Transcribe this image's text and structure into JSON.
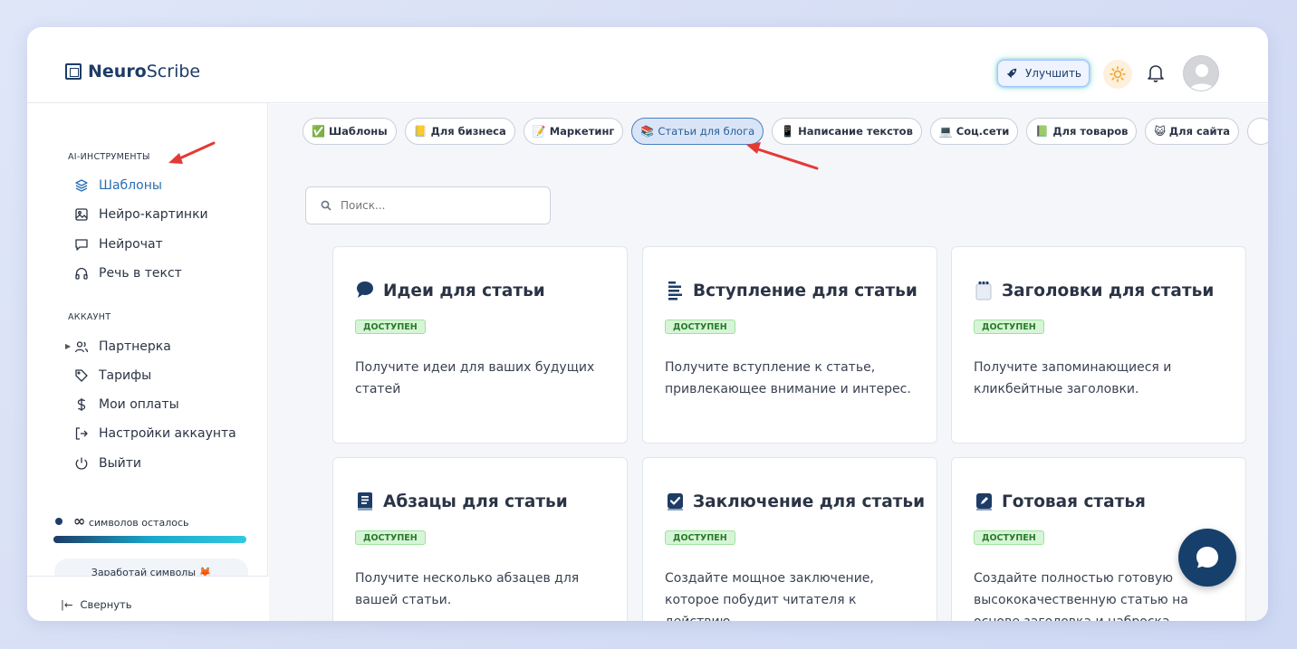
{
  "app": {
    "brand_bold": "Neuro",
    "brand_light": "Scribe"
  },
  "header": {
    "upgrade_label": "Улучшить"
  },
  "sidebar": {
    "section_tools": "AI-ИНСТРУМЕНТЫ",
    "tools": [
      {
        "label": "Шаблоны",
        "icon": "layers-icon",
        "active": true
      },
      {
        "label": "Нейро-картинки",
        "icon": "image-icon"
      },
      {
        "label": "Нейрочат",
        "icon": "chat-icon"
      },
      {
        "label": "Речь в текст",
        "icon": "headphones-icon"
      }
    ],
    "section_account": "АККАУНТ",
    "account": [
      {
        "label": "Партнерка",
        "icon": "users-icon"
      },
      {
        "label": "Тарифы",
        "icon": "tag-icon"
      },
      {
        "label": "Мои оплаты",
        "icon": "dollar-icon"
      },
      {
        "label": "Настройки аккаунта",
        "icon": "logout-icon"
      },
      {
        "label": "Выйти",
        "icon": "power-icon"
      }
    ],
    "credits_symbol": "∞",
    "credits_text": "символов осталось",
    "credits_progress": 1.0,
    "earn_label": "Заработай символы 🦊",
    "collapse_label": "Свернуть"
  },
  "categories": [
    {
      "emoji": "✅",
      "label": "Шаблоны"
    },
    {
      "emoji": "📒",
      "label": "Для бизнеса"
    },
    {
      "emoji": "📝",
      "label": "Маркетинг"
    },
    {
      "emoji": "📚",
      "label": "Статьи для блога",
      "active": true
    },
    {
      "emoji": "📱",
      "label": "Написание текстов"
    },
    {
      "emoji": "💻",
      "label": "Соц.сети"
    },
    {
      "emoji": "📗",
      "label": "Для товаров"
    },
    {
      "emoji": "😺",
      "label": "Для сайта"
    }
  ],
  "search": {
    "placeholder": "Поиск..."
  },
  "cards": [
    {
      "title": "Идеи для статьи",
      "icon": "speech-bubble-icon",
      "badge": "ДОСТУПЕН",
      "desc": "Получите идеи для ваших будущих статей"
    },
    {
      "title": "Вступление для статьи",
      "icon": "text-lines-icon",
      "badge": "ДОСТУПЕН",
      "desc": "Получите вступление к статье, привлекающее внимание и интерес."
    },
    {
      "title": "Заголовки для статьи",
      "icon": "notepad-icon",
      "badge": "ДОСТУПЕН",
      "desc": "Получите запоминающиеся и кликбейтные заголовки."
    },
    {
      "title": "Абзацы для статьи",
      "icon": "book-icon",
      "badge": "ДОСТУПЕН",
      "desc": "Получите несколько абзацев для вашей статьи."
    },
    {
      "title": "Заключение для статьи",
      "icon": "check-box-icon",
      "badge": "ДОСТУПЕН",
      "desc": "Создайте мощное заключение, которое побудит читателя к действию."
    },
    {
      "title": "Готовая статья",
      "icon": "pen-square-icon",
      "badge": "ДОСТУПЕН",
      "desc": "Создайте полностью готовую высококачественную статью на основе заголовка и наброска"
    }
  ],
  "colors": {
    "brand": "#1d3c66",
    "accent": "#2a6fb3",
    "badge_bg": "#d6f5d6",
    "annotation_arrow": "#e53935"
  }
}
